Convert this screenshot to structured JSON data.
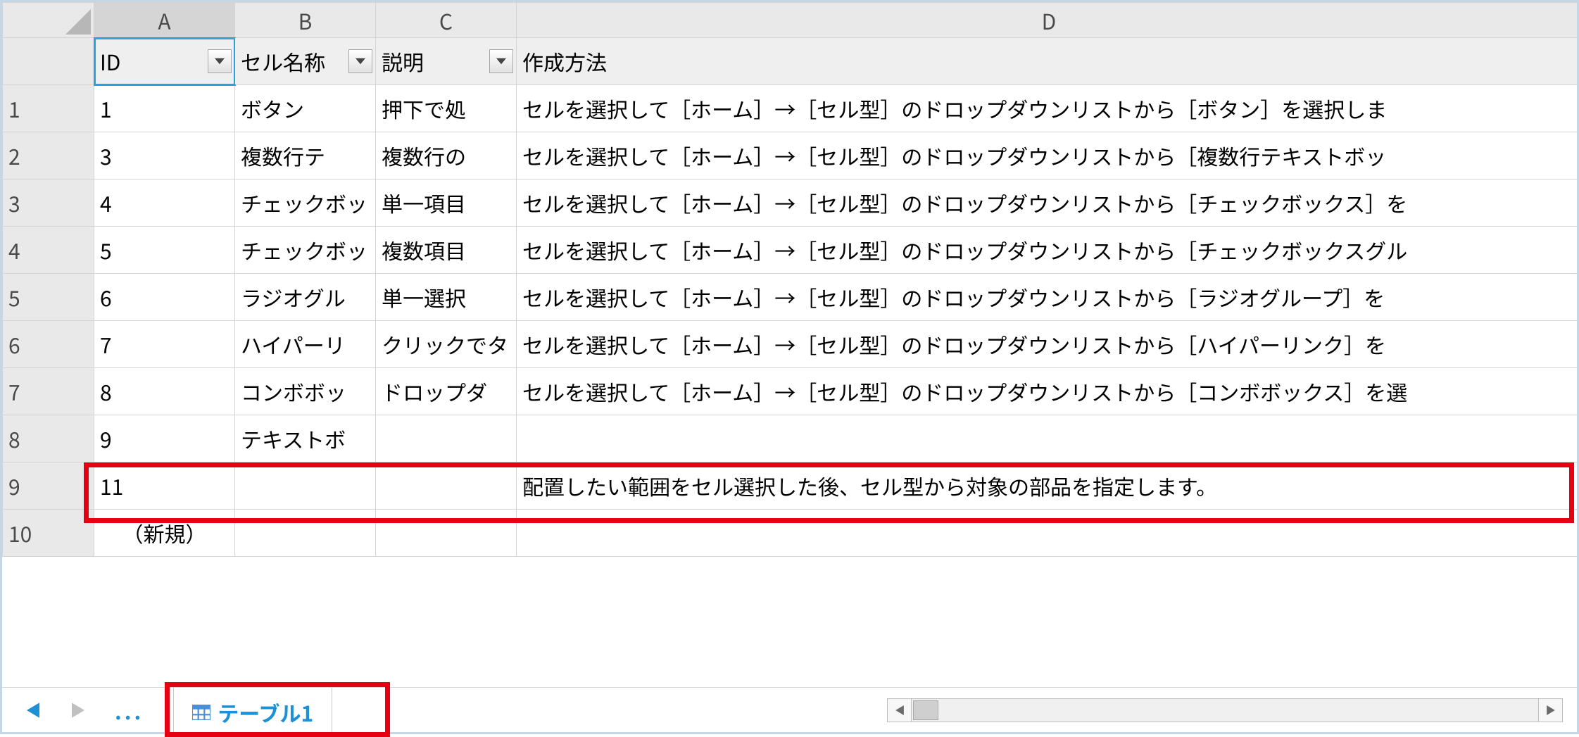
{
  "columns": {
    "A": "A",
    "B": "B",
    "C": "C",
    "D": "D"
  },
  "filterHeaders": {
    "A": "ID",
    "B": "セル名称",
    "C": "説明",
    "D": "作成方法"
  },
  "rows": [
    {
      "num": "1",
      "A": "1",
      "B": "ボタン",
      "C": "押下で処",
      "D": "セルを選択して［ホーム］→［セル型］のドロップダウンリストから［ボタン］を選択しま"
    },
    {
      "num": "2",
      "A": "3",
      "B": "複数行テ",
      "C": "複数行の",
      "D": "セルを選択して［ホーム］→［セル型］のドロップダウンリストから［複数行テキストボッ"
    },
    {
      "num": "3",
      "A": "4",
      "B": "チェックボッ",
      "C": "単一項目",
      "D": "セルを選択して［ホーム］→［セル型］のドロップダウンリストから［チェックボックス］を"
    },
    {
      "num": "4",
      "A": "5",
      "B": "チェックボッ",
      "C": "複数項目",
      "D": "セルを選択して［ホーム］→［セル型］のドロップダウンリストから［チェックボックスグル"
    },
    {
      "num": "5",
      "A": "6",
      "B": "ラジオグル",
      "C": "単一選択",
      "D": "セルを選択して［ホーム］→［セル型］のドロップダウンリストから［ラジオグループ］を"
    },
    {
      "num": "6",
      "A": "7",
      "B": "ハイパーリ",
      "C": "クリックでタ",
      "D": "セルを選択して［ホーム］→［セル型］のドロップダウンリストから［ハイパーリンク］を"
    },
    {
      "num": "7",
      "A": "8",
      "B": "コンボボッ",
      "C": "ドロップダ",
      "D": "セルを選択して［ホーム］→［セル型］のドロップダウンリストから［コンボボックス］を選"
    },
    {
      "num": "8",
      "A": "9",
      "B": "テキストボ",
      "C": "",
      "D": ""
    },
    {
      "num": "9",
      "A": "11",
      "B": "",
      "C": "",
      "D": "配置したい範囲をセル選択した後、セル型から対象の部品を指定します。"
    },
    {
      "num": "10",
      "A": "（新規）",
      "B": "",
      "C": "",
      "D": ""
    }
  ],
  "sheetTab": {
    "label": "テーブル1"
  },
  "nav": {
    "ellipsis": "..."
  }
}
